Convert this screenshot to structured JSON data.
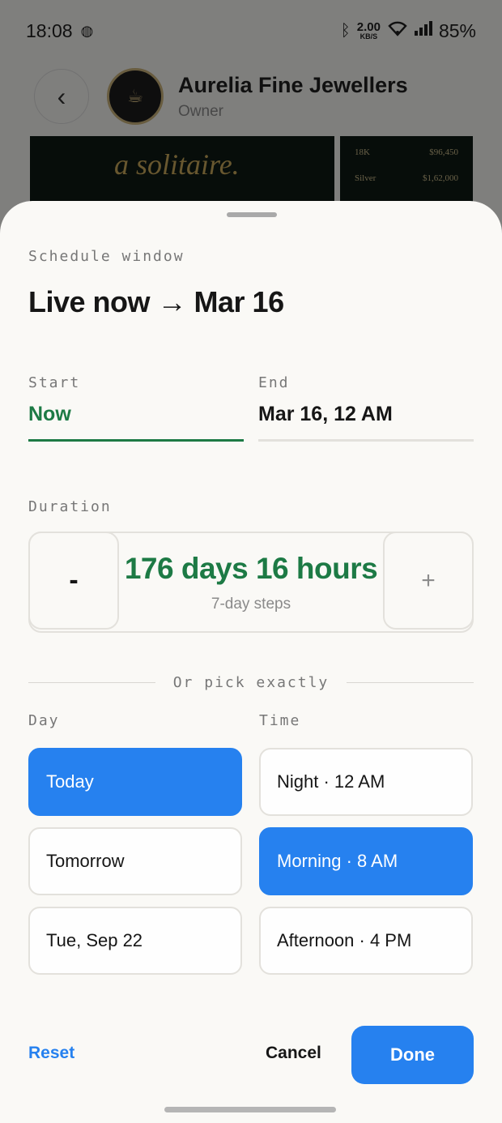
{
  "status_bar": {
    "time": "18:08",
    "net_speed_value": "2.00",
    "net_speed_unit": "KB/S",
    "battery": "85%",
    "icons": [
      "globe-icon",
      "bluetooth-icon",
      "wifi-icon",
      "signal-icon"
    ]
  },
  "background_app": {
    "store_name": "Aurelia Fine Jewellers",
    "store_role": "Owner",
    "banner_tagline": "a solitaire.",
    "rates": [
      {
        "label": "18K",
        "value": "$96,450"
      },
      {
        "label": "Silver",
        "value": "$1,62,000"
      }
    ]
  },
  "sheet": {
    "section_label": "Schedule window",
    "headline": "Live now → Mar 16",
    "start": {
      "label": "Start",
      "value": "Now"
    },
    "end": {
      "label": "End",
      "value": "Mar 16, 12 AM"
    },
    "duration": {
      "label": "Duration",
      "minus": "-",
      "plus": "+",
      "value": "176 days 16 hours",
      "step_hint": "7-day steps"
    },
    "divider_text": "Or pick exactly",
    "day": {
      "label": "Day",
      "options": [
        "Today",
        "Tomorrow",
        "Tue, Sep 22"
      ],
      "selected": "Today"
    },
    "time": {
      "label": "Time",
      "options": [
        "Night · 12 AM",
        "Morning · 8 AM",
        "Afternoon · 4 PM"
      ],
      "selected": "Morning · 8 AM"
    },
    "footer": {
      "reset": "Reset",
      "cancel": "Cancel",
      "done": "Done"
    }
  },
  "colors": {
    "accent": "#2681ef",
    "green": "#1d7a45",
    "sheet_bg": "#faf9f6"
  }
}
